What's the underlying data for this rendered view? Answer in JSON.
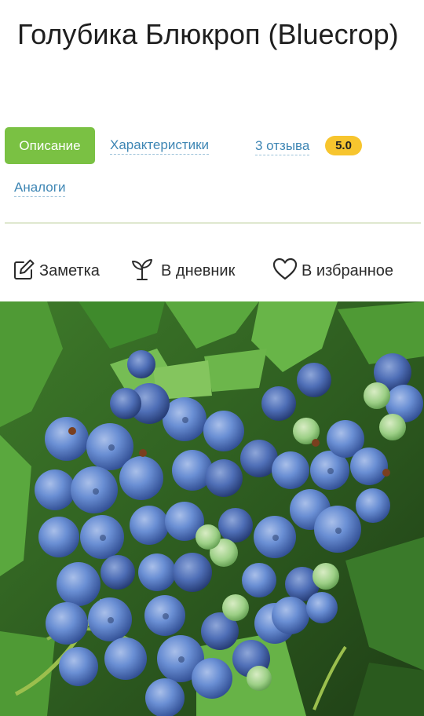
{
  "product": {
    "title": "Голубика Блюкроп (Bluecrop)"
  },
  "tabs": {
    "description": "Описание",
    "characteristics": "Характеристики",
    "reviews": "3 отзыва",
    "rating": "5.0",
    "analogs": "Аналоги"
  },
  "actions": {
    "note": "Заметка",
    "diary": "В дневник",
    "favorites": "В избранное"
  },
  "colors": {
    "accent_green": "#7ac143",
    "link_blue": "#3e86b4",
    "rating_yellow": "#f7c52e"
  },
  "icons": {
    "note": "edit-icon",
    "diary": "sprout-icon",
    "favorites": "heart-icon"
  },
  "image": {
    "subject": "photo-blueberry-cluster"
  }
}
